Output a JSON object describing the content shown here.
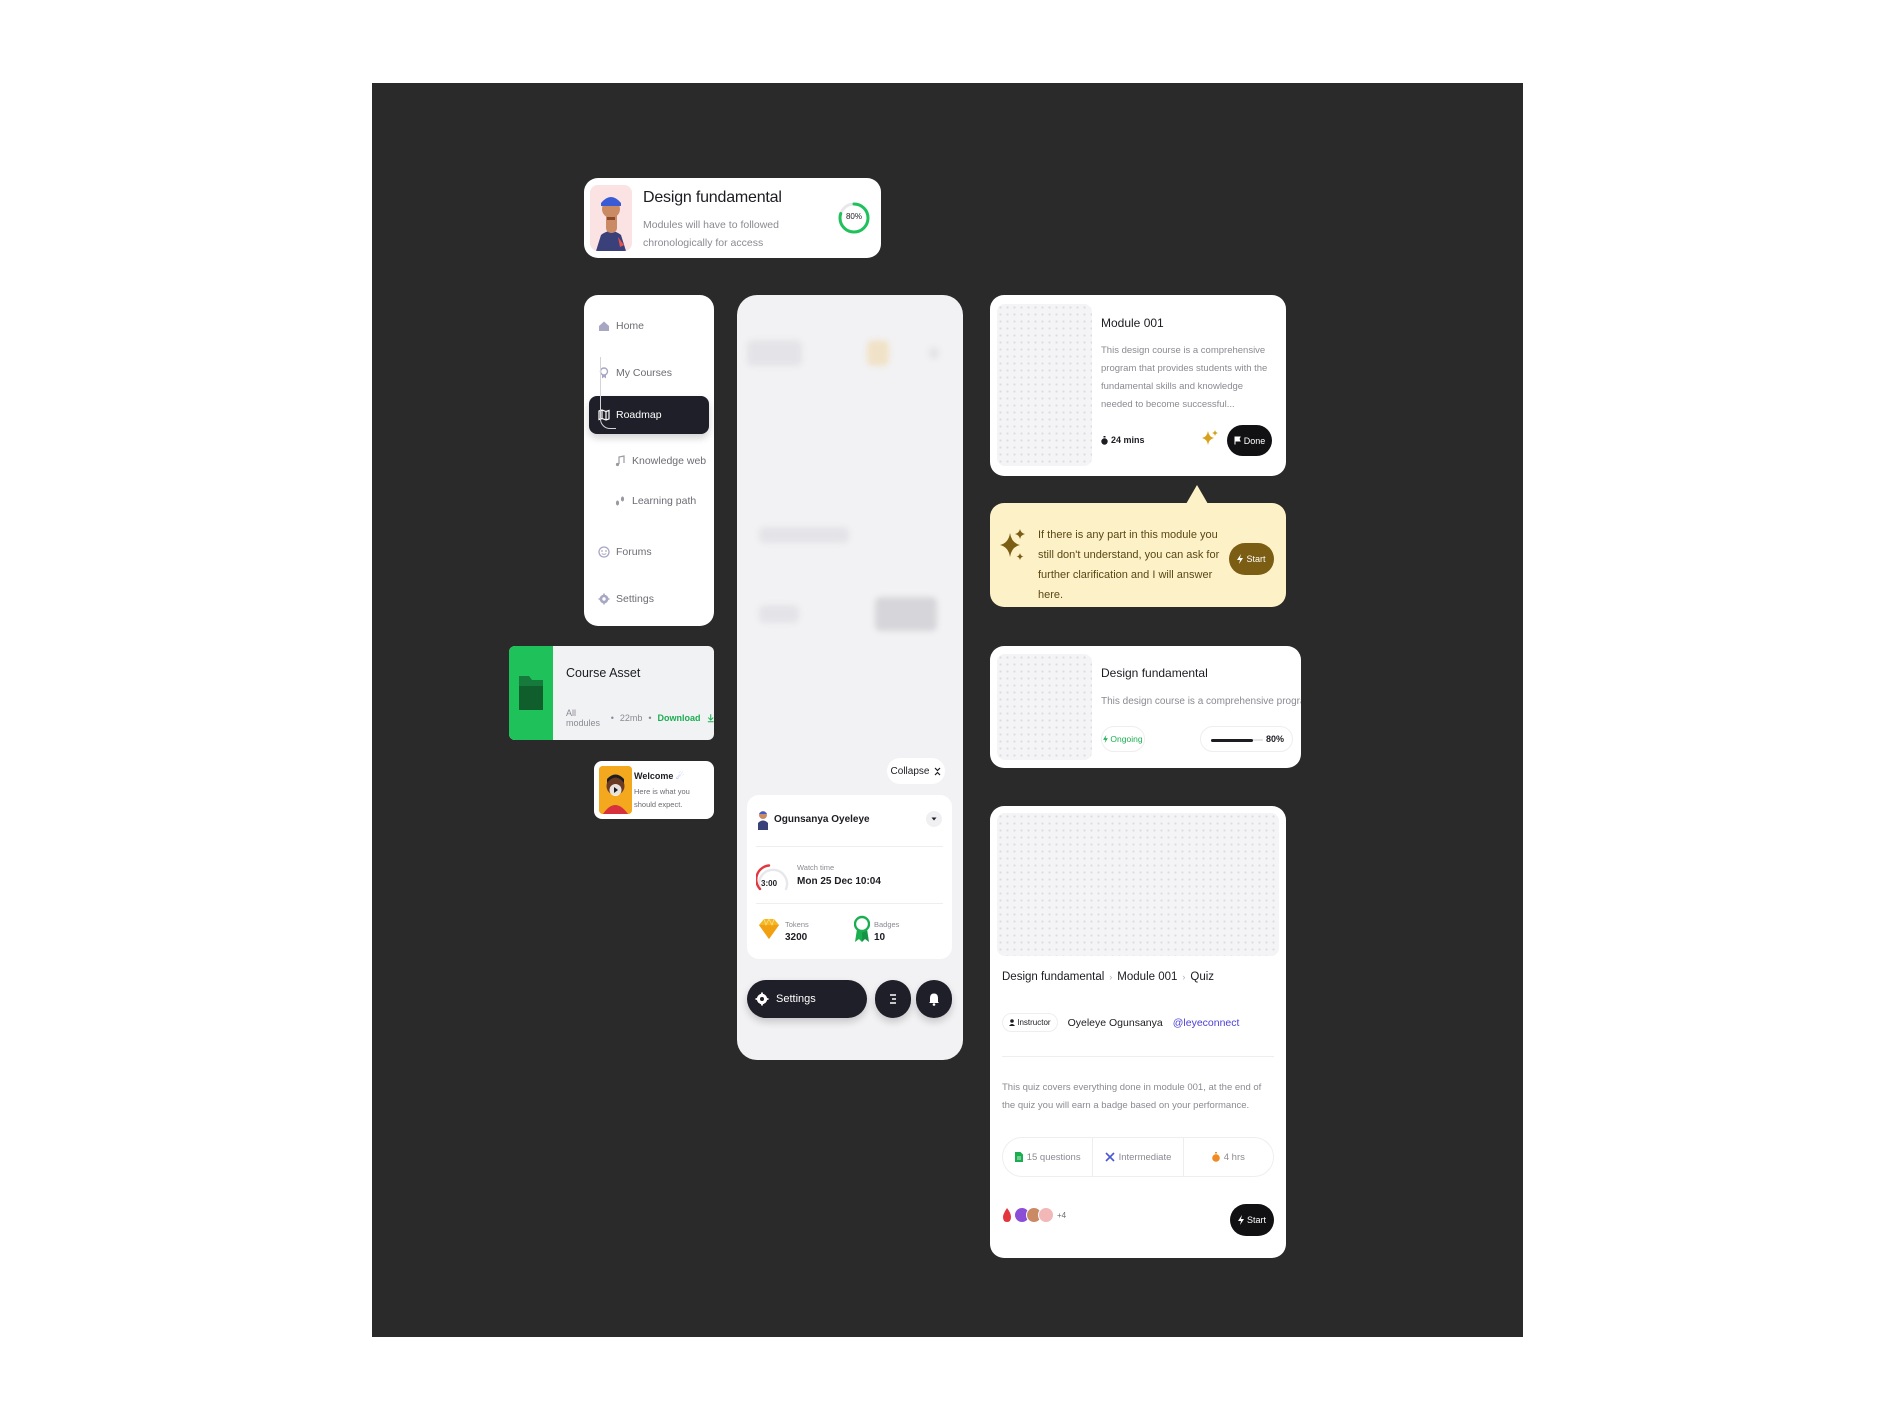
{
  "course_header": {
    "title": "Design fundamental",
    "subtitle": "Modules will have to followed chronologically for access",
    "progress_label": "80%",
    "progress": 0.8,
    "progress_color": "#1fc15b"
  },
  "sidebar": {
    "items": [
      {
        "label": "Home",
        "icon": "home-icon"
      },
      {
        "label": "My Courses",
        "icon": "courses-icon"
      },
      {
        "label": "Roadmap",
        "icon": "map-icon",
        "active": true
      },
      {
        "label": "Forums",
        "icon": "forum-icon"
      },
      {
        "label": "Settings",
        "icon": "gear-icon"
      }
    ],
    "sub_items": [
      {
        "label": "Knowledge web",
        "icon": "music-note-icon"
      },
      {
        "label": "Learning path",
        "icon": "footsteps-icon"
      }
    ]
  },
  "course_asset": {
    "title": "Course Asset",
    "scope": "All modules",
    "size": "22mb",
    "download_label": "Download",
    "accent": "#1fc15b"
  },
  "welcome": {
    "title": "Welcome",
    "text": "Here is what you should expect."
  },
  "panel": {
    "collapse_label": "Collapse",
    "user_name": "Ogunsanya Oyeleye",
    "watch_time_label": "Watch time",
    "watch_time_value": "Mon 25 Dec 10:04",
    "watch_gauge_label": "3:00",
    "tokens_label": "Tokens",
    "tokens_value": "3200",
    "badges_label": "Badges",
    "badges_value": "10",
    "settings_label": "Settings"
  },
  "module_card": {
    "title": "Module 001",
    "description": "This design course is a comprehensive program that provides students with the fundamental skills and knowledge needed to become successful...",
    "duration": "24 mins",
    "done_label": "Done"
  },
  "ai_helper": {
    "message": "If there is any part in this module you still don't understand, you can ask for further clarification and I will answer here.",
    "start_label": "Start",
    "background": "#fdf1c7",
    "accent": "#7b5d14"
  },
  "course_progress": {
    "title": "Design fundamental",
    "description": "This design course is a comprehensive program...",
    "status": "Ongoing",
    "progress_label": "80%",
    "progress": 0.8
  },
  "quiz_card": {
    "breadcrumb": [
      "Design fundamental",
      "Module 001",
      "Quiz"
    ],
    "instructor_label": "Instructor",
    "instructor_name": "Oyeleye Ogunsanya",
    "instructor_handle": "@leyeconnect",
    "description": "This quiz covers everything done in module 001, at the end of the quiz you will earn a badge based on your performance.",
    "stats": [
      {
        "label": "15 questions",
        "icon": "document-icon"
      },
      {
        "label": "Intermediate",
        "icon": "tools-icon"
      },
      {
        "label": "4 hrs",
        "icon": "timer-icon"
      }
    ],
    "participants_more": "+4",
    "start_label": "Start"
  }
}
